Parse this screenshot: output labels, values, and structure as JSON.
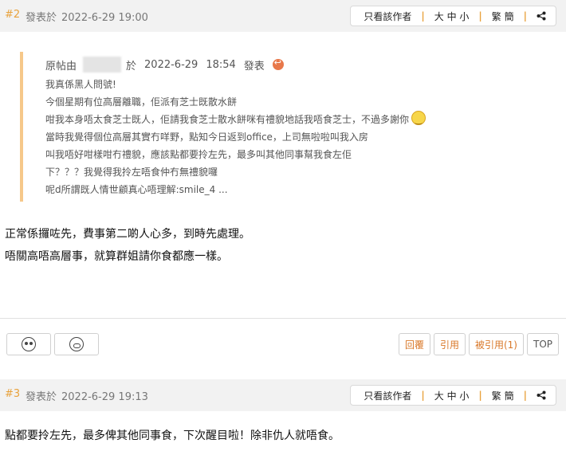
{
  "post2": {
    "number": "#2",
    "meta_label": "發表於",
    "time": "2022-6-29 19:00",
    "toolbar": {
      "author_only": "只看該作者",
      "font_size": "大 中 小",
      "traditional": "繁 簡"
    },
    "quote": {
      "prefix": "原帖由",
      "at": "於",
      "date": "2022-6-29",
      "time": "18:54",
      "posted": "發表",
      "lines": [
        "我真係黑人問號!",
        "今個星期有位高層離職，佢派有芝士既散水餅",
        "咁我本身唔太食芝士既人，佢請我食芝士散水餅咪有禮貌地話我唔食芝士，不過多謝你",
        "當時我覺得個位高層其實冇咩野，點知今日返到office，上司無啦啦叫我入房",
        "叫我唔好咁樣咁冇禮貌，應該點都要拎左先，最多叫其他同事幫我食左佢",
        "下？？？我覺得我拎左唔食仲冇無禮貌囉",
        "呢d所謂既人情世顧真心唔理解:smile_4  ..."
      ]
    },
    "body": [
      "正常係攞咗先，費事第二啲人心多，到時先處理。",
      "唔關高唔高層事，就算群姐請你食都應一樣。"
    ],
    "actions": {
      "reply": "回覆",
      "quote": "引用",
      "quoted": "被引用(1)",
      "top": "TOP"
    }
  },
  "post3": {
    "number": "#3",
    "meta_label": "發表於",
    "time": "2022-6-29 19:13",
    "toolbar": {
      "author_only": "只看該作者",
      "font_size": "大 中 小",
      "traditional": "繁 簡"
    },
    "body": [
      "點都要拎左先，最多俾其他同事食，下次醒目啦！除非仇人就唔食。"
    ]
  },
  "icons": [
    "share-icon",
    "goto-post-icon",
    "smiley-emoticon",
    "love-face-icon",
    "pig-face-icon"
  ],
  "colors": {
    "accent": "#e8a23c",
    "quote_border": "#f6c88a",
    "action_text": "#d9782a"
  }
}
